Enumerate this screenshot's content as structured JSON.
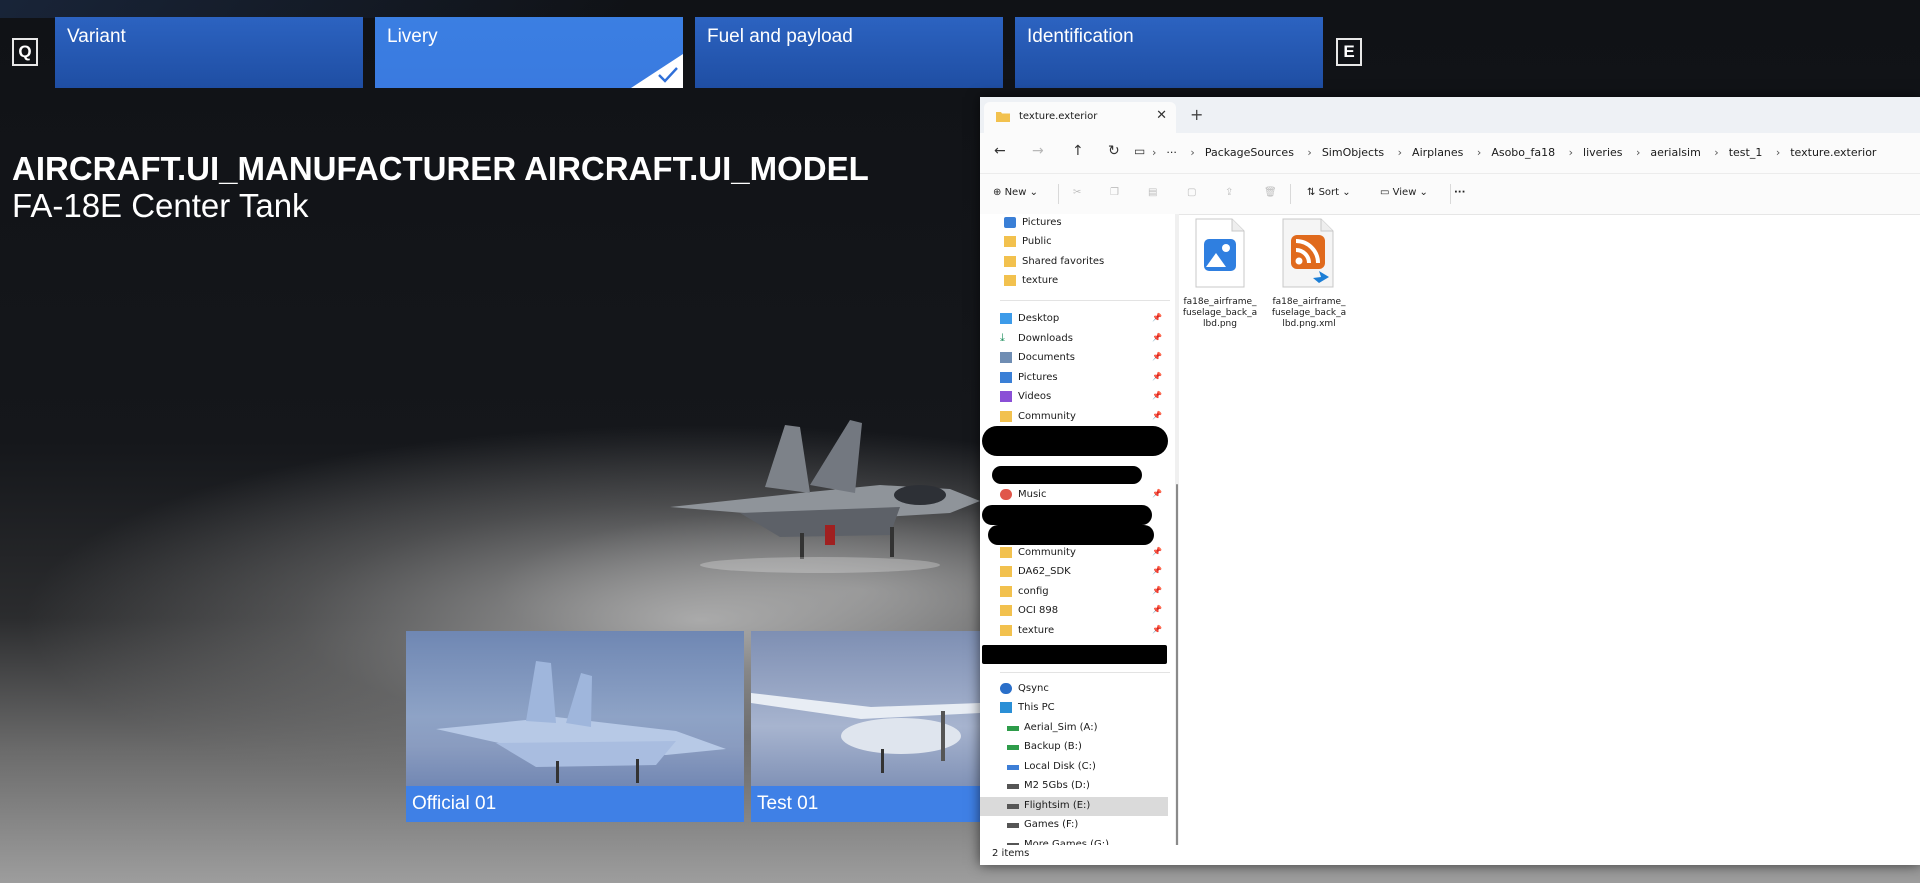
{
  "keys": {
    "left": "Q",
    "right": "E"
  },
  "tabs": [
    {
      "label": "Variant"
    },
    {
      "label": "Livery"
    },
    {
      "label": "Fuel and payload"
    },
    {
      "label": "Identification"
    }
  ],
  "aircraft": {
    "title": "AIRCRAFT.UI_MANUFACTURER AIRCRAFT.UI_MODEL",
    "subtitle": "FA-18E Center Tank"
  },
  "liveries": [
    {
      "label": "Official 01"
    },
    {
      "label": "Test 01"
    }
  ],
  "explorer": {
    "tab_title": "texture.exterior",
    "breadcrumbs": [
      "PackageSources",
      "SimObjects",
      "Airplanes",
      "Asobo_fa18",
      "liveries",
      "aerialsim",
      "test_1",
      "texture.exterior"
    ],
    "commands": {
      "new": "New",
      "sort": "Sort",
      "view": "View",
      "more": "···"
    },
    "sidebar": {
      "quick": [
        "Pictures",
        "Public",
        "Shared favorites",
        "texture"
      ],
      "pinned": [
        "Desktop",
        "Downloads",
        "Documents",
        "Pictures",
        "Videos",
        "Community"
      ],
      "music": "Music",
      "pinned2": [
        "Community",
        "DA62_SDK",
        "config",
        "OCI 898",
        "texture"
      ],
      "qsync": "Qsync",
      "this_pc": "This PC",
      "drives": [
        "Aerial_Sim (A:)",
        "Backup (B:)",
        "Local Disk (C:)",
        "M2 5Gbs (D:)",
        "Flightsim (E:)",
        "Games (F:)",
        "More Games (G:)"
      ]
    },
    "files": [
      {
        "name": "fa18e_airframe_fuselage_back_albd.png",
        "icon": "png-image-icon"
      },
      {
        "name": "fa18e_airframe_fuselage_back_albd.png.xml",
        "icon": "xml-rss-vscode-icon"
      }
    ],
    "status": "2 items"
  },
  "colors": {
    "tab": "#1f4ea3",
    "tab_active": "#3a7ae0",
    "caption": "#3f80e6"
  }
}
